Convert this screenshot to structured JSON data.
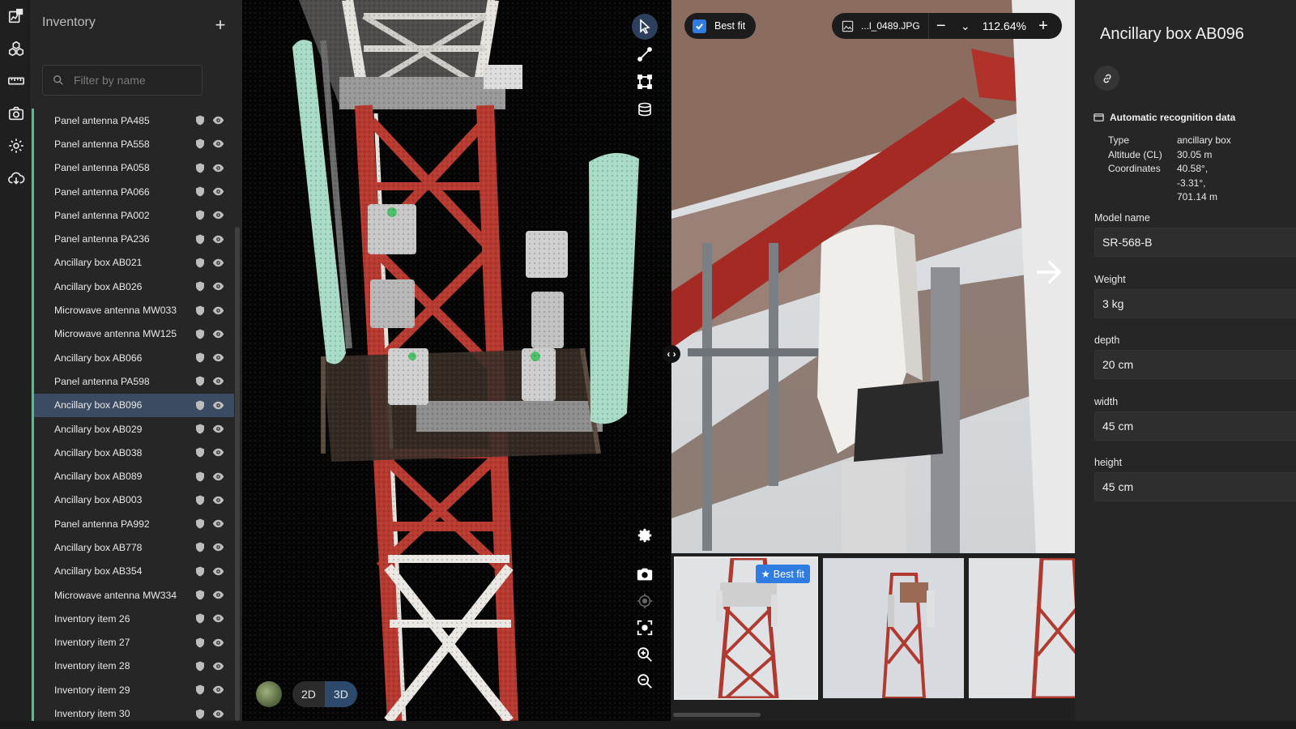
{
  "rail": {
    "icons": [
      "analytics-icon",
      "components-icon",
      "measure-icon",
      "camera-icon",
      "settings-icon",
      "cloud-download-icon"
    ]
  },
  "inventory": {
    "title": "Inventory",
    "add_label": "+",
    "filter_placeholder": "Filter by name",
    "selected_index": 12,
    "items": [
      "Panel antenna PA485",
      "Panel antenna PA558",
      "Panel antenna PA058",
      "Panel antenna PA066",
      "Panel antenna PA002",
      "Panel antenna PA236",
      "Ancillary box AB021",
      "Ancillary box AB026",
      "Microwave antenna MW033",
      "Microwave antenna MW125",
      "Ancillary box AB066",
      "Panel antenna PA598",
      "Ancillary box AB096",
      "Ancillary box AB029",
      "Ancillary box AB038",
      "Ancillary box AB089",
      "Ancillary box AB003",
      "Panel antenna PA992",
      "Ancillary box AB778",
      "Ancillary box AB354",
      "Microwave antenna MW334",
      "Inventory item 26",
      "Inventory item 27",
      "Inventory item 28",
      "Inventory item 29",
      "Inventory item 30"
    ]
  },
  "viewer": {
    "mode_2d": "2D",
    "mode_3d": "3D",
    "active_mode": "3D"
  },
  "photo": {
    "best_fit_label": "Best fit",
    "best_fit_checked": true,
    "file_name": "...l_0489.JPG",
    "zoom_minus": "−",
    "zoom_value": "112.64%",
    "zoom_plus": "+"
  },
  "thumbnails": {
    "badge": "Best fit"
  },
  "details": {
    "title": "Ancillary box AB096",
    "recognition_title": "Automatic recognition data",
    "recognition": [
      {
        "key": "Type",
        "value": "ancillary box"
      },
      {
        "key": "Altitude (CL)",
        "value": "30.05 m"
      },
      {
        "key": "Coordinates",
        "value": "40.58°,\n-3.31°,\n701.14 m"
      }
    ],
    "fields": [
      {
        "label": "Model name",
        "value": "SR-568-B"
      },
      {
        "label": "Weight",
        "value": "3 kg"
      },
      {
        "label": "depth",
        "value": "20 cm"
      },
      {
        "label": "width",
        "value": "45 cm"
      },
      {
        "label": "height",
        "value": "45 cm"
      }
    ]
  },
  "colors": {
    "accent": "#2f7de1",
    "row_marker": "#45c58a",
    "selected_row": "#3a4b62",
    "tower_red": "#c0392b"
  }
}
